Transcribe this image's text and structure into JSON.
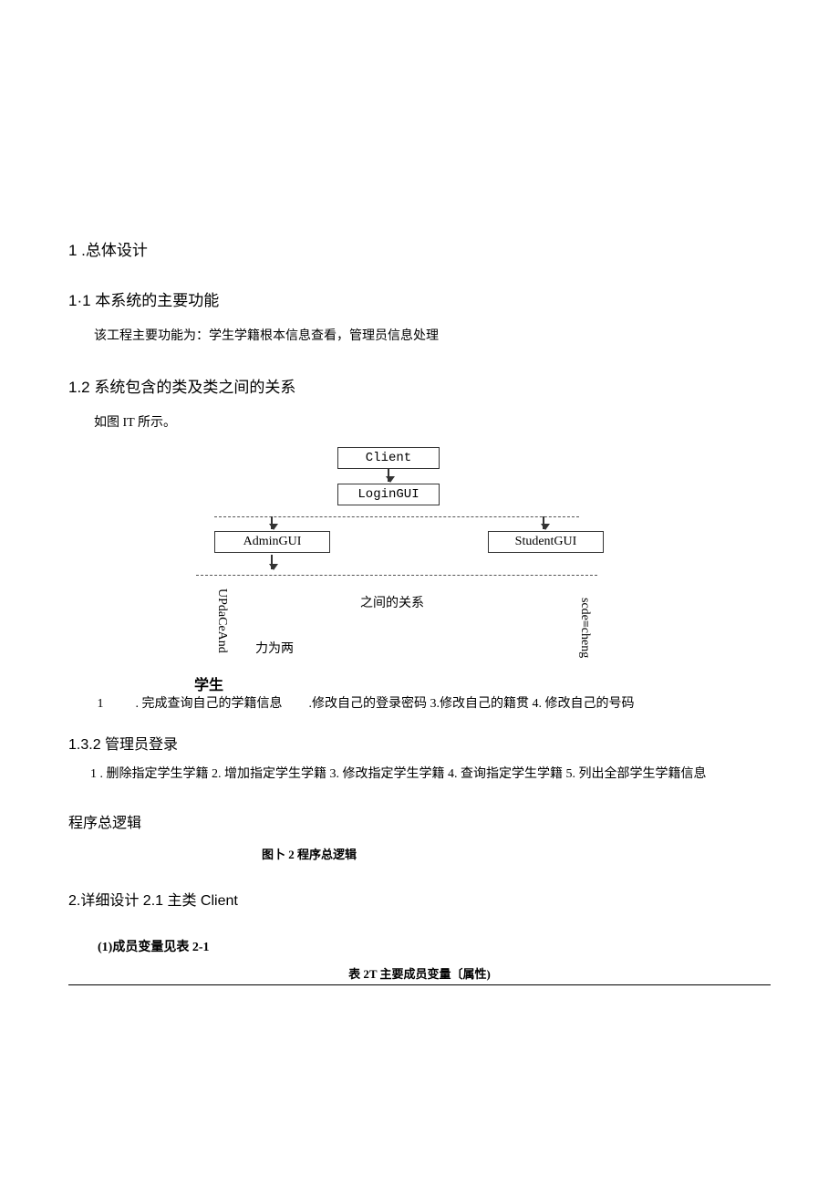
{
  "headings": {
    "h1": "1 .总体设计",
    "h11": "1·1 本系统的主要功能",
    "h12": "1.2 系统包含的类及类之间的关系",
    "h132": "1.3.2 管理员登录",
    "hlogic": "程序总逻辑",
    "h2": "2.详细设计 2.1 主类 Client"
  },
  "paragraphs": {
    "p11": "该工程主要功能为：学生学籍根本信息查看，管理员信息处理",
    "p12": "如图 IT 所示。",
    "p131_a": "1",
    "p131_b": ". 完成查询自己的学籍信息",
    "p131_c": ".修改自己的登录密码 3.修改自己的籍贯  4. 修改自己的号码",
    "p132": "1  . 删除指定学生学籍 2. 增加指定学生学籍 3. 修改指定学生学籍 4. 查询指定学生学籍 5. 列出全部学生学籍信息",
    "subtitle21": "(1)成员变量见表 2-1"
  },
  "diagram": {
    "client": "Client",
    "login": "LoginGUI",
    "admin": "AdminGUI",
    "student_gui": "StudentGUI",
    "updatceand": "UPdaCeAnd",
    "liweiliang": "力为两",
    "student": "学生",
    "relation": "之间的关系",
    "scde_cheng": "scde≡cheng"
  },
  "captions": {
    "fig2": "图卜 2 程序总逻辑",
    "table2t": "表 2T 主要成员变量〔属性)"
  }
}
